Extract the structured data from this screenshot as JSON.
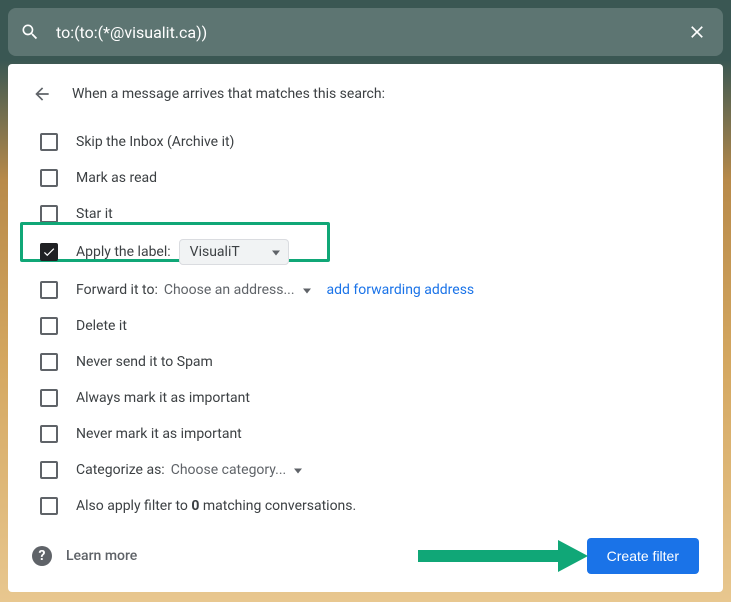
{
  "search": {
    "query": "to:(to:(*@visualit.ca))"
  },
  "header": {
    "title": "When a message arrives that matches this search:"
  },
  "options": {
    "skip_inbox": "Skip the Inbox (Archive it)",
    "mark_read": "Mark as read",
    "star": "Star it",
    "apply_label": "Apply the label:",
    "apply_label_value": "VisualiT",
    "forward": "Forward it to:",
    "forward_value": "Choose an address...",
    "forward_link": "add forwarding address",
    "delete": "Delete it",
    "never_spam": "Never send it to Spam",
    "always_important": "Always mark it as important",
    "never_important": "Never mark it as important",
    "categorize": "Categorize as:",
    "categorize_value": "Choose category...",
    "also_apply_pre": "Also apply filter to ",
    "also_apply_count": "0",
    "also_apply_post": " matching conversations."
  },
  "footer": {
    "learn_more": "Learn more",
    "create_filter": "Create filter"
  }
}
